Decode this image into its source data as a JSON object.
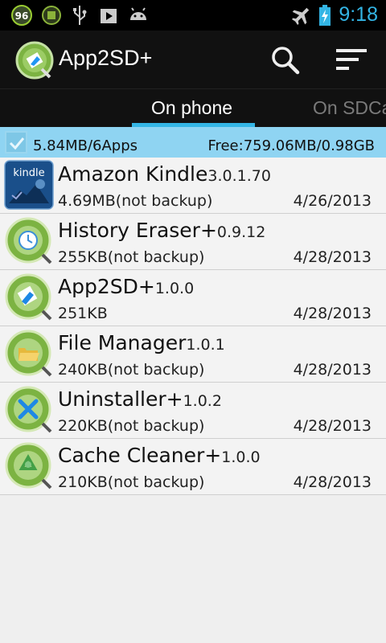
{
  "status_bar": {
    "badge_number": "96",
    "time": "9:18",
    "icons": [
      "notification-badge-icon",
      "app2sd-notification-icon",
      "usb-icon",
      "play-store-icon",
      "android-debug-icon",
      "airplane-mode-icon",
      "battery-icon"
    ]
  },
  "action_bar": {
    "title": "App2SD+",
    "icons": [
      "app-logo-icon",
      "search-icon",
      "sort-icon"
    ]
  },
  "tabs": [
    {
      "label": "On phone",
      "active": true
    },
    {
      "label": "On SDCa",
      "active": false
    }
  ],
  "summary": {
    "checked": true,
    "left_text": "5.84MB/6Apps",
    "right_text": "Free:759.06MB/0.98GB"
  },
  "apps": [
    {
      "name": "Amazon Kindle",
      "version": "3.0.1.70",
      "size": "4.69MB(not backup)",
      "date": "4/26/2013",
      "icon": "kindle-icon"
    },
    {
      "name": "History Eraser+",
      "version": "0.9.12",
      "size": "255KB(not backup)",
      "date": "4/28/2013",
      "icon": "history-eraser-icon"
    },
    {
      "name": "App2SD+",
      "version": "1.0.0",
      "size": "251KB",
      "date": "4/28/2013",
      "icon": "app2sd-icon"
    },
    {
      "name": "File Manager",
      "version": "1.0.1",
      "size": "240KB(not backup)",
      "date": "4/28/2013",
      "icon": "file-manager-icon"
    },
    {
      "name": "Uninstaller+",
      "version": "1.0.2",
      "size": "220KB(not backup)",
      "date": "4/28/2013",
      "icon": "uninstaller-icon"
    },
    {
      "name": "Cache Cleaner+",
      "version": "1.0.0",
      "size": "210KB(not backup)",
      "date": "4/28/2013",
      "icon": "cache-cleaner-icon"
    }
  ],
  "colors": {
    "accent": "#33b5e5",
    "summary_background": "#8fd4f2",
    "action_bar": "#111111"
  }
}
